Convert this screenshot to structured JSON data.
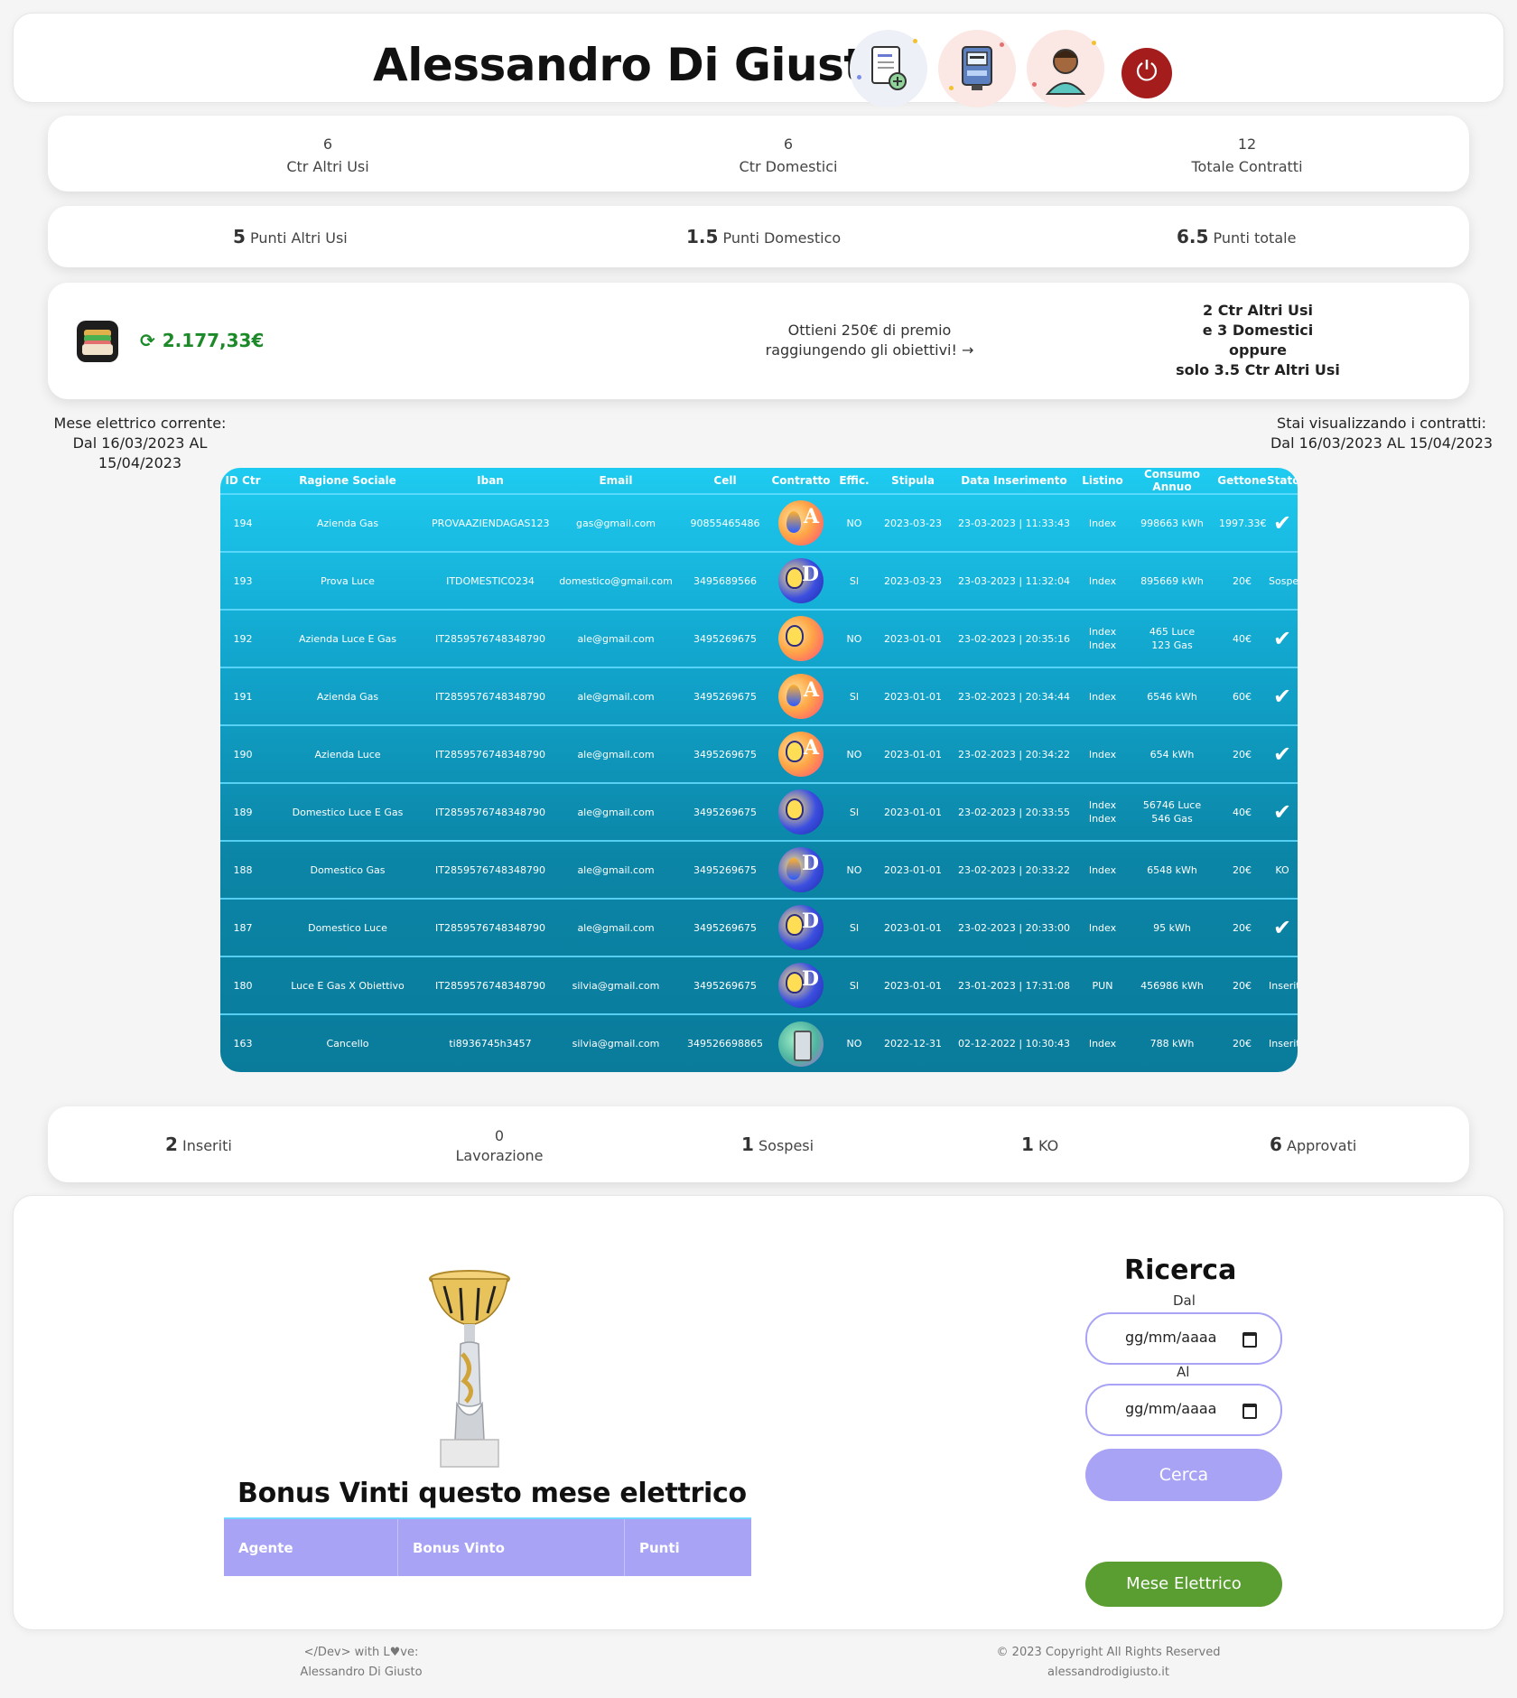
{
  "header": {
    "title": "Alessandro Di Giusto",
    "icons": [
      "new-contract-icon",
      "meter-icon",
      "agent-avatar-icon",
      "power-icon"
    ]
  },
  "contracts_summary": [
    {
      "value": "6",
      "label": "Ctr Altri Usi"
    },
    {
      "value": "6",
      "label": "Ctr Domestici"
    },
    {
      "value": "12",
      "label": "Totale Contratti"
    }
  ],
  "points_summary": [
    {
      "value": "5",
      "label": "Punti Altri Usi"
    },
    {
      "value": "1.5",
      "label": "Punti Domestico"
    },
    {
      "value": "6.5",
      "label": "Punti totale"
    }
  ],
  "wallet": {
    "balance": "2.177,33€",
    "prize_line1": "Ottieni 250€ di premio",
    "prize_line2": "raggiungendo gli obiettivi! →",
    "goal_lines": [
      "2 Ctr Altri Usi",
      "e 3 Domestici",
      "oppure",
      "solo 3.5 Ctr Altri Usi"
    ]
  },
  "period_left": {
    "line1": "Mese elettrico corrente:",
    "line2": "Dal 16/03/2023 AL 15/04/2023"
  },
  "period_right": {
    "line1": "Stai visualizzando i contratti:",
    "line2": "Dal 16/03/2023 AL 15/04/2023"
  },
  "table": {
    "headers": [
      "ID Ctr",
      "Ragione Sociale",
      "Iban",
      "Email",
      "Cell",
      "Contratto",
      "Effic.",
      "Stipula",
      "Data Inserimento",
      "Listino",
      "Consumo Annuo",
      "Gettone",
      "Stato"
    ],
    "rows": [
      {
        "id": "194",
        "ragione": "Azienda Gas",
        "iban": "PROVAAZIENDAGAS123",
        "email": "gas@gmail.com",
        "cell": "90855465486",
        "icon": "gas-icon",
        "letter": "A",
        "style": "warm",
        "eff": "NO",
        "stipula": "2023-03-23",
        "ins": "23-03-2023 | 11:33:43",
        "listino": "Index",
        "listino2": "",
        "consumo": "998663 kWh",
        "consumo2": "",
        "gettone": "1997.33€",
        "stato": "✔"
      },
      {
        "id": "193",
        "ragione": "Prova Luce",
        "iban": "ITDOMESTICO234",
        "email": "domestico@gmail.com",
        "cell": "3495689566",
        "icon": "bulb-icon",
        "letter": "D",
        "style": "blue",
        "eff": "SI",
        "stipula": "2023-03-23",
        "ins": "23-03-2023 | 11:32:04",
        "listino": "Index",
        "listino2": "",
        "consumo": "895669 kWh",
        "consumo2": "",
        "gettone": "20€",
        "stato": "Sospeso"
      },
      {
        "id": "192",
        "ragione": "Azienda Luce E Gas",
        "iban": "IT2859576748348790",
        "email": "ale@gmail.com",
        "cell": "3495269675",
        "icon": "bulb-icon",
        "letter": "",
        "style": "warm",
        "eff": "NO",
        "stipula": "2023-01-01",
        "ins": "23-02-2023 | 20:35:16",
        "listino": "Index",
        "listino2": "Index",
        "consumo": "465 Luce",
        "consumo2": "123 Gas",
        "gettone": "40€",
        "stato": "✔"
      },
      {
        "id": "191",
        "ragione": "Azienda Gas",
        "iban": "IT2859576748348790",
        "email": "ale@gmail.com",
        "cell": "3495269675",
        "icon": "gas-icon",
        "letter": "A",
        "style": "warm",
        "eff": "SI",
        "stipula": "2023-01-01",
        "ins": "23-02-2023 | 20:34:44",
        "listino": "Index",
        "listino2": "",
        "consumo": "6546 kWh",
        "consumo2": "",
        "gettone": "60€",
        "stato": "✔"
      },
      {
        "id": "190",
        "ragione": "Azienda Luce",
        "iban": "IT2859576748348790",
        "email": "ale@gmail.com",
        "cell": "3495269675",
        "icon": "bulb-icon",
        "letter": "A",
        "style": "warm",
        "eff": "NO",
        "stipula": "2023-01-01",
        "ins": "23-02-2023 | 20:34:22",
        "listino": "Index",
        "listino2": "",
        "consumo": "654 kWh",
        "consumo2": "",
        "gettone": "20€",
        "stato": "✔"
      },
      {
        "id": "189",
        "ragione": "Domestico Luce E Gas",
        "iban": "IT2859576748348790",
        "email": "ale@gmail.com",
        "cell": "3495269675",
        "icon": "bulb-icon",
        "letter": "",
        "style": "blue",
        "eff": "SI",
        "stipula": "2023-01-01",
        "ins": "23-02-2023 | 20:33:55",
        "listino": "Index",
        "listino2": "Index",
        "consumo": "56746 Luce",
        "consumo2": "546 Gas",
        "gettone": "40€",
        "stato": "✔"
      },
      {
        "id": "188",
        "ragione": "Domestico Gas",
        "iban": "IT2859576748348790",
        "email": "ale@gmail.com",
        "cell": "3495269675",
        "icon": "gas-icon",
        "letter": "D",
        "style": "blue",
        "eff": "NO",
        "stipula": "2023-01-01",
        "ins": "23-02-2023 | 20:33:22",
        "listino": "Index",
        "listino2": "",
        "consumo": "6548 kWh",
        "consumo2": "",
        "gettone": "20€",
        "stato": "KO"
      },
      {
        "id": "187",
        "ragione": "Domestico Luce",
        "iban": "IT2859576748348790",
        "email": "ale@gmail.com",
        "cell": "3495269675",
        "icon": "bulb-icon",
        "letter": "D",
        "style": "blue",
        "eff": "SI",
        "stipula": "2023-01-01",
        "ins": "23-02-2023 | 20:33:00",
        "listino": "Index",
        "listino2": "",
        "consumo": "95 kWh",
        "consumo2": "",
        "gettone": "20€",
        "stato": "✔"
      },
      {
        "id": "180",
        "ragione": "Luce E Gas X Obiettivo",
        "iban": "IT2859576748348790",
        "email": "silvia@gmail.com",
        "cell": "3495269675",
        "icon": "bulb-icon",
        "letter": "D",
        "style": "blue",
        "eff": "SI",
        "stipula": "2023-01-01",
        "ins": "23-01-2023 | 17:31:08",
        "listino": "PUN",
        "listino2": "",
        "consumo": "456986 kWh",
        "consumo2": "",
        "gettone": "20€",
        "stato": "Inserito"
      },
      {
        "id": "163",
        "ragione": "Cancello",
        "iban": "ti8936745h3457",
        "email": "silvia@gmail.com",
        "cell": "349526698865",
        "icon": "gate-icon",
        "letter": "",
        "style": "gate",
        "eff": "NO",
        "stipula": "2022-12-31",
        "ins": "02-12-2022 | 10:30:43",
        "listino": "Index",
        "listino2": "",
        "consumo": "788 kWh",
        "consumo2": "",
        "gettone": "20€",
        "stato": "Inserito"
      }
    ]
  },
  "status_summary": [
    {
      "value": "2",
      "label": "Inseriti"
    },
    {
      "value": "0",
      "label": "Lavorazione"
    },
    {
      "value": "1",
      "label": "Sospesi"
    },
    {
      "value": "1",
      "label": "KO"
    },
    {
      "value": "6",
      "label": "Approvati"
    }
  ],
  "bonus": {
    "title": "Bonus Vinti questo mese elettrico",
    "headers": [
      "Agente",
      "Bonus Vinto",
      "Punti"
    ]
  },
  "search": {
    "title": "Ricerca",
    "from_label": "Dal",
    "to_label": "Al",
    "from_value": "gg/mm/aaaa",
    "to_value": "gg/mm/aaaa",
    "search_button": "Cerca",
    "month_button": "Mese Elettrico",
    "accent": "#a8a3f5",
    "month_color": "#5a9e31"
  },
  "footer": {
    "left_line1": "</Dev> with L♥ve:",
    "left_line2": "Alessandro Di Giusto",
    "right_line1": "© 2023 Copyright All Rights Reserved",
    "right_line2": "alessandrodigiusto.it"
  }
}
